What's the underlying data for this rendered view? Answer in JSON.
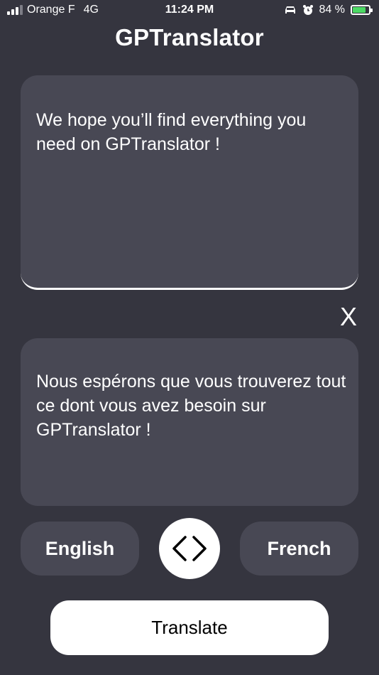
{
  "status_bar": {
    "carrier": "Orange F",
    "network": "4G",
    "time": "11:24 PM",
    "battery": "84 %",
    "battery_level": 0.84,
    "icons": [
      "signal-icon",
      "car-icon",
      "alarm-icon",
      "battery-icon"
    ]
  },
  "app": {
    "title": "GPTranslator"
  },
  "input": {
    "text": "We hope you’ll find everything you need on GPTranslator !"
  },
  "clear": {
    "label": "X"
  },
  "output": {
    "text": "Nous espérons que vous trouverez tout ce dont vous avez besoin sur GPTranslator !"
  },
  "languages": {
    "source": "English",
    "target": "French",
    "swap_icon": "swap-arrows-icon"
  },
  "actions": {
    "translate_label": "Translate"
  },
  "colors": {
    "background": "#35353f",
    "card": "#484854",
    "accent": "#ffffff",
    "battery_fill": "#4cd964"
  }
}
